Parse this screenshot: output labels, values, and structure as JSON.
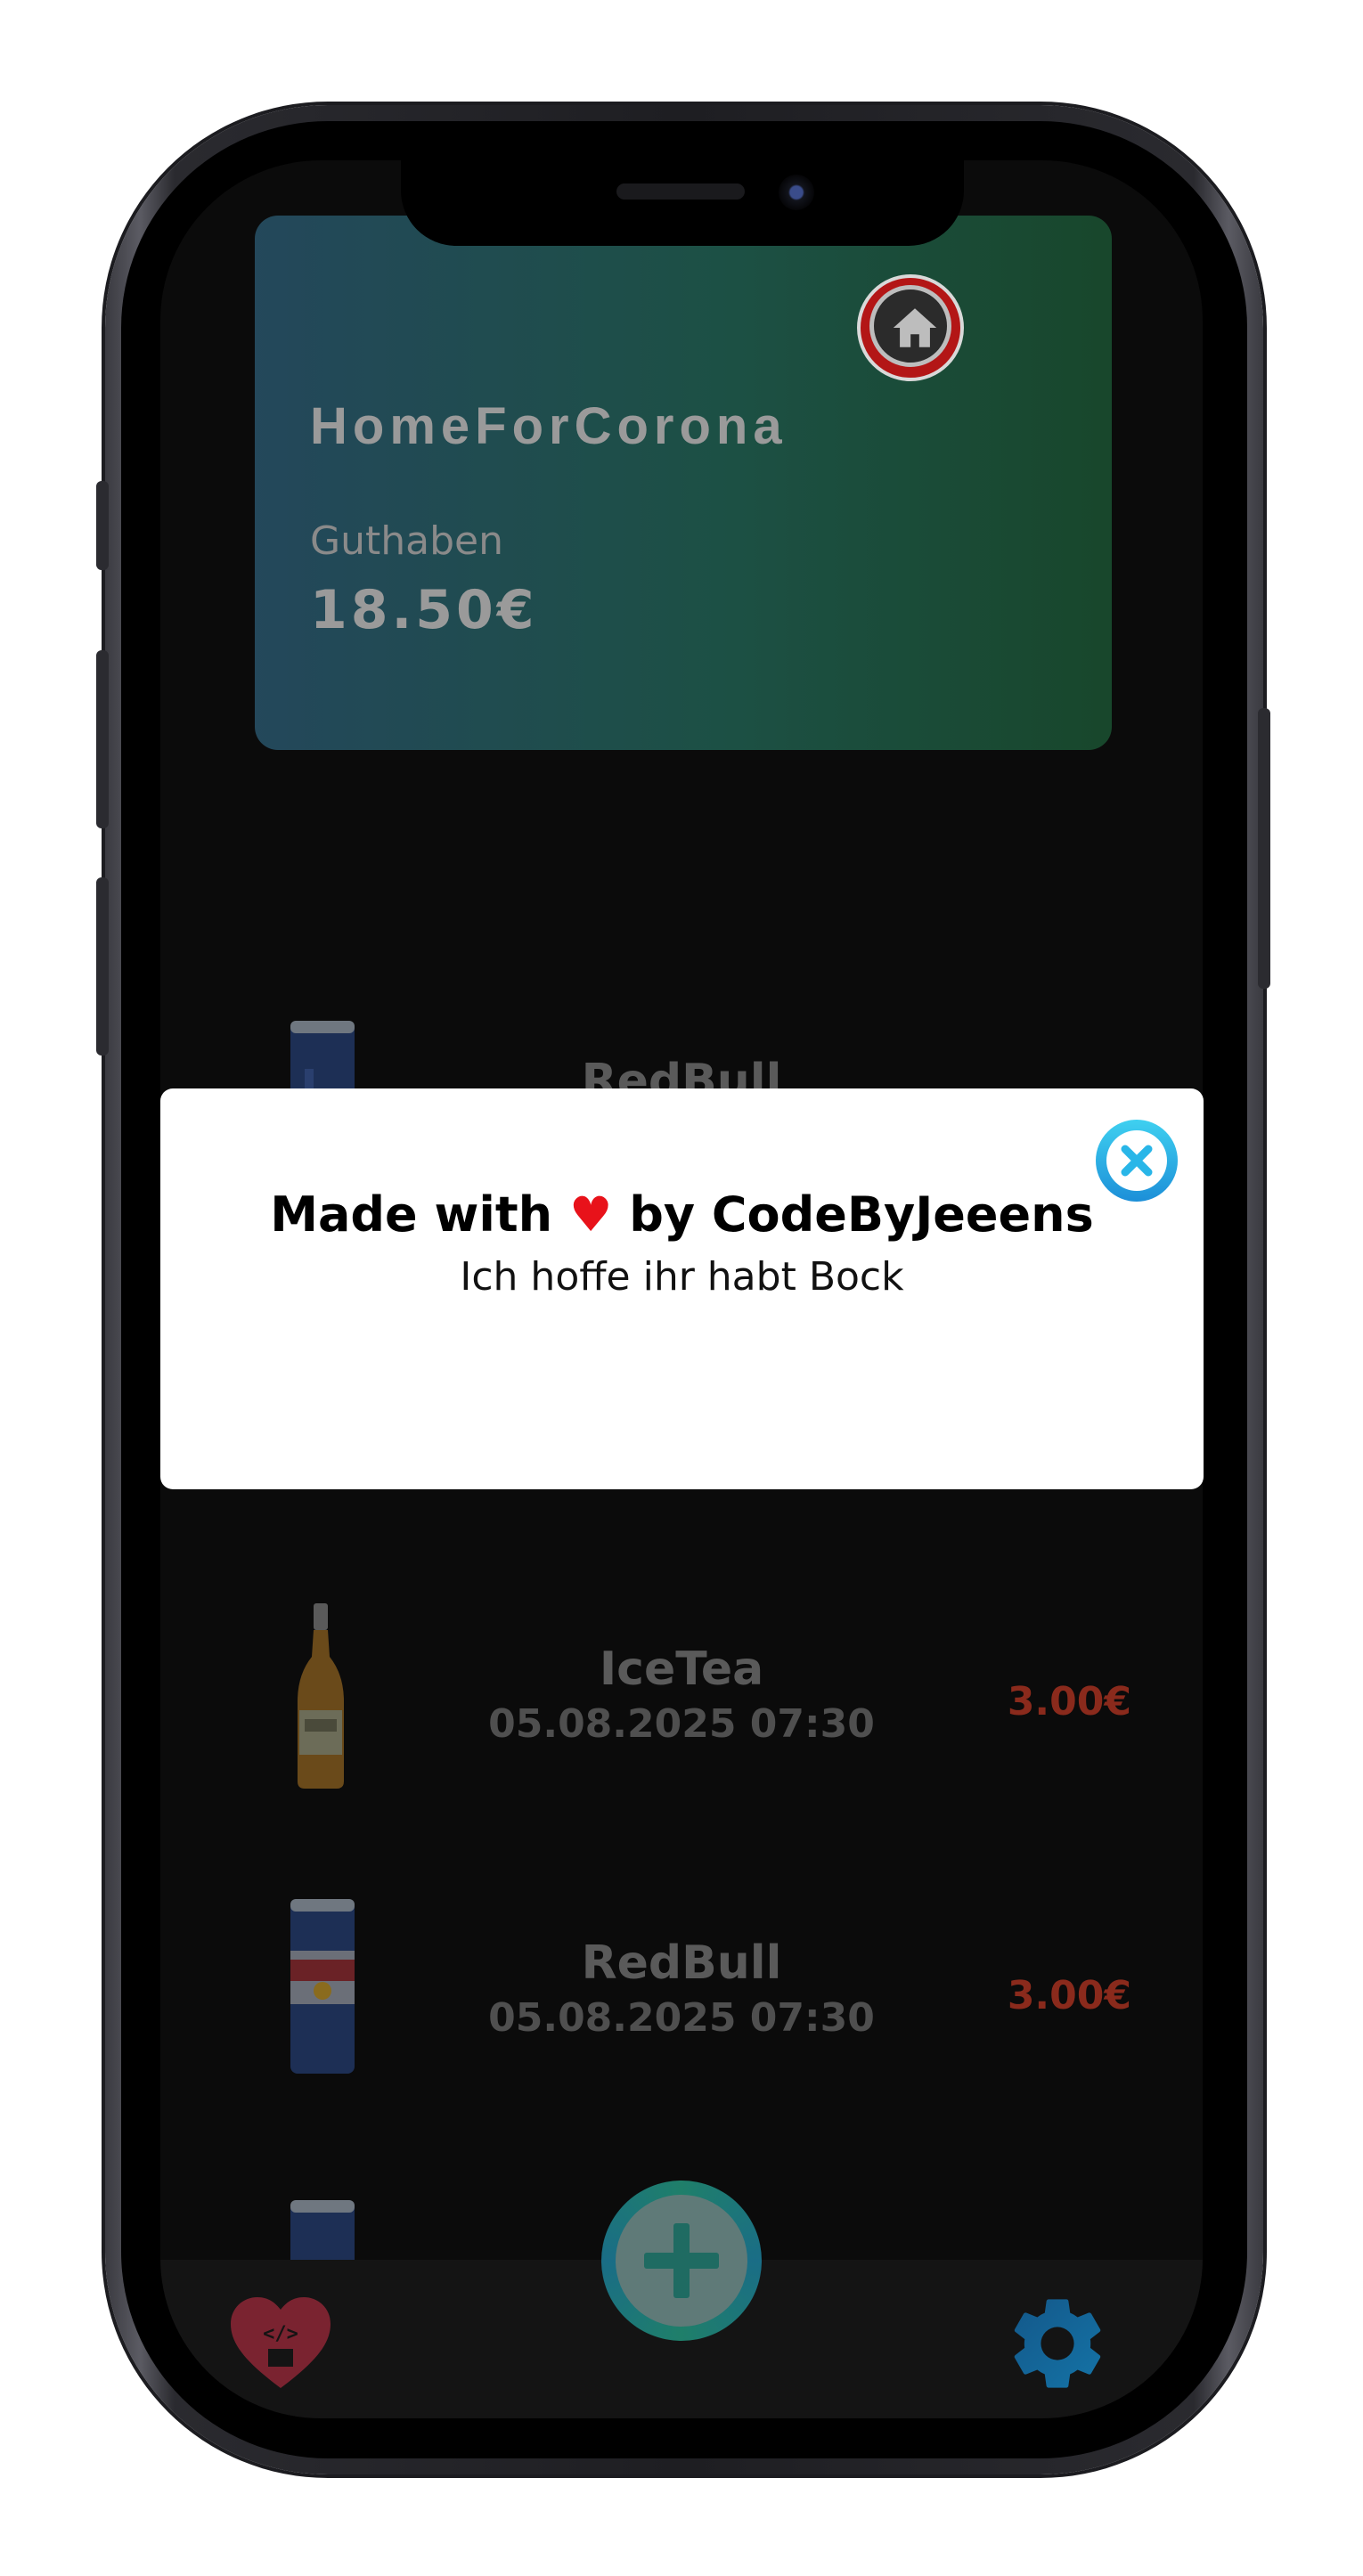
{
  "app": {
    "card": {
      "title": "HomeForCorona",
      "balance_label": "Guthaben",
      "balance_value": "18.50€",
      "logo_icon": "home-icon"
    },
    "transactions": [
      {
        "name": "RedBull",
        "date": "",
        "price": "",
        "image": "redbull-can"
      },
      {
        "name": "IceTea",
        "date": "05.08.2025 07:30",
        "price": "3.00€",
        "image": "icetea-bottle"
      },
      {
        "name": "RedBull",
        "date": "05.08.2025 07:30",
        "price": "3.00€",
        "image": "redbull-can"
      },
      {
        "name": "",
        "date": "",
        "price": "",
        "image": "redbull-can"
      }
    ],
    "bottom_bar": {
      "left_icon": "heart-code-icon",
      "center_icon": "plus-icon",
      "right_icon": "gear-icon"
    },
    "colors": {
      "price": "#8a2a1c",
      "fab": "#1f7f6a",
      "modal_heart": "#e8121a",
      "close_icon": "#29b6e8"
    }
  },
  "modal": {
    "title_prefix": "Made with",
    "heart": "♥",
    "title_suffix": "by CodeByJeeens",
    "subtitle": "Ich hoffe ihr habt Bock",
    "close_icon": "close-circle-icon"
  }
}
